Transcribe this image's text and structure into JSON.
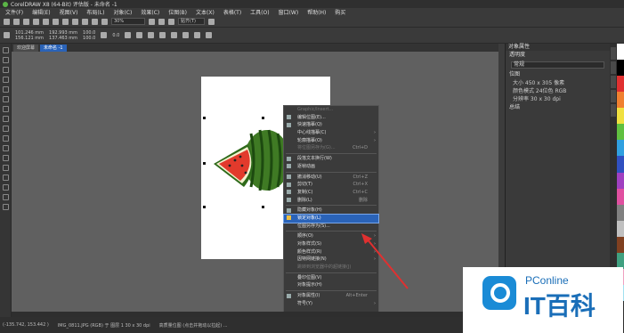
{
  "titlebar": {
    "title": "CorelDRAW X8 (64-Bit) 评估版 - 未命名 -1"
  },
  "menu": [
    "文件(F)",
    "编辑(E)",
    "视图(V)",
    "布局(L)",
    "对象(C)",
    "效果(C)",
    "位图(B)",
    "文本(X)",
    "表格(T)",
    "工具(O)",
    "窗口(W)",
    "帮助(H)",
    "购买"
  ],
  "toolbar": {
    "zoom": "30%",
    "snap": "贴齐(T)"
  },
  "propbar": {
    "x": "101.246 mm",
    "y": "156.121 mm",
    "w": "192.993 mm",
    "h": "137.463 mm",
    "sx": "100.0",
    "sy": "100.0",
    "angle": "0.0"
  },
  "tabs": [
    "欢迎屏幕",
    "未命名 -1"
  ],
  "context_menu": {
    "items": [
      {
        "label": "Graphic/Insert...",
        "disabled": true
      },
      {
        "label": "编辑位图(E)...",
        "icon": "edit-bitmap-icon"
      },
      {
        "label": "快速描摹(Q)",
        "icon": "trace-icon"
      },
      {
        "label": "中心线描摹(C)",
        "submenu": true
      },
      {
        "label": "轮廓描摹(O)",
        "submenu": true
      },
      {
        "label": "将位图另存为(G)...",
        "shortcut": "Ctrl+D",
        "disabled": true
      },
      {
        "sep": true
      },
      {
        "label": "段落文本换行(W)",
        "icon": "wrap-icon"
      },
      {
        "label": "逐帧动画",
        "icon": "frame-icon"
      },
      {
        "sep": true
      },
      {
        "label": "撤消移动(U)",
        "shortcut": "Ctrl+Z",
        "icon": "undo-icon"
      },
      {
        "label": "剪切(T)",
        "shortcut": "Ctrl+X",
        "icon": "cut-icon"
      },
      {
        "label": "复制(C)",
        "shortcut": "Ctrl+C",
        "icon": "copy-icon"
      },
      {
        "label": "删除(L)",
        "shortcut": "删除",
        "icon": "delete-icon"
      },
      {
        "sep": true
      },
      {
        "label": "隐藏对象(H)",
        "icon": "hide-icon"
      },
      {
        "label": "锁定对象(L)",
        "icon": "lock-icon",
        "highlight": true
      },
      {
        "label": "位图另存为(S)..."
      },
      {
        "sep": true
      },
      {
        "label": "顺序(O)",
        "submenu": true
      },
      {
        "label": "对象样式(S)",
        "submenu": true
      },
      {
        "label": "颜色样式(R)",
        "submenu": true
      },
      {
        "label": "因特网链接(N)",
        "submenu": true
      },
      {
        "label": "跳转到浏览器中的超链接(J)",
        "disabled": true
      },
      {
        "sep": true
      },
      {
        "label": "叠印位图(V)"
      },
      {
        "label": "对象提示(H)"
      },
      {
        "sep": true
      },
      {
        "label": "对象属性(I)",
        "shortcut": "Alt+Enter",
        "icon": "check-icon"
      },
      {
        "label": "符号(Y)",
        "submenu": true
      }
    ]
  },
  "rpanel": {
    "header": "对象属性",
    "transparency_section": "透明度",
    "mode": "常规",
    "bitmap_section": "位图",
    "size": "大小 450 x 305 像素",
    "color_mode": "颜色模式 24位色 RGB",
    "resolution": "分辨率 30 x 30 dpi",
    "summary_section": "总结"
  },
  "statusbar": {
    "coords": "(-135.742, 153.442 )",
    "info": "IMG_0811.JPG (RGB) 于 图层 1 30 x 30 dpi",
    "hint": "高质量位图 (点击并拖动以拉起) ..."
  },
  "logo": {
    "brand": "PConline",
    "cn": "IT百科"
  },
  "colors": {
    "accent": "#2a63b8",
    "watermark": "#1a8bd6",
    "arrow": "#e03030"
  }
}
